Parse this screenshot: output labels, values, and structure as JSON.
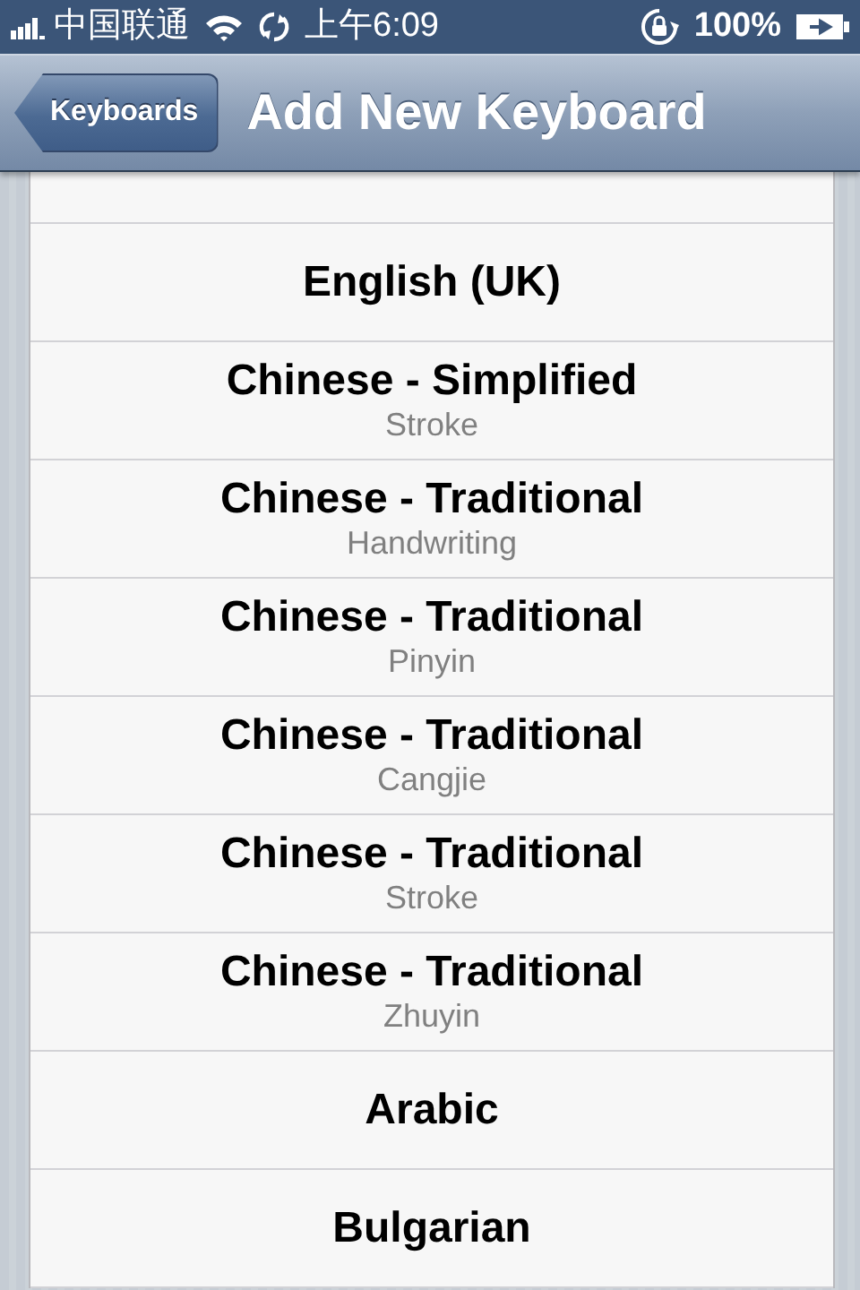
{
  "status_bar": {
    "carrier": "中国联通",
    "time": "上午6:09",
    "battery": "100%"
  },
  "nav_bar": {
    "back_button": "Keyboards",
    "title": "Add New Keyboard"
  },
  "keyboards": [
    {
      "name": "English (UK)"
    },
    {
      "name": "Chinese - Simplified",
      "detail": "Stroke"
    },
    {
      "name": "Chinese - Traditional",
      "detail": "Handwriting"
    },
    {
      "name": "Chinese - Traditional",
      "detail": "Pinyin"
    },
    {
      "name": "Chinese - Traditional",
      "detail": "Cangjie"
    },
    {
      "name": "Chinese - Traditional",
      "detail": "Stroke"
    },
    {
      "name": "Chinese - Traditional",
      "detail": "Zhuyin"
    },
    {
      "name": "Arabic"
    },
    {
      "name": "Bulgarian"
    }
  ]
}
